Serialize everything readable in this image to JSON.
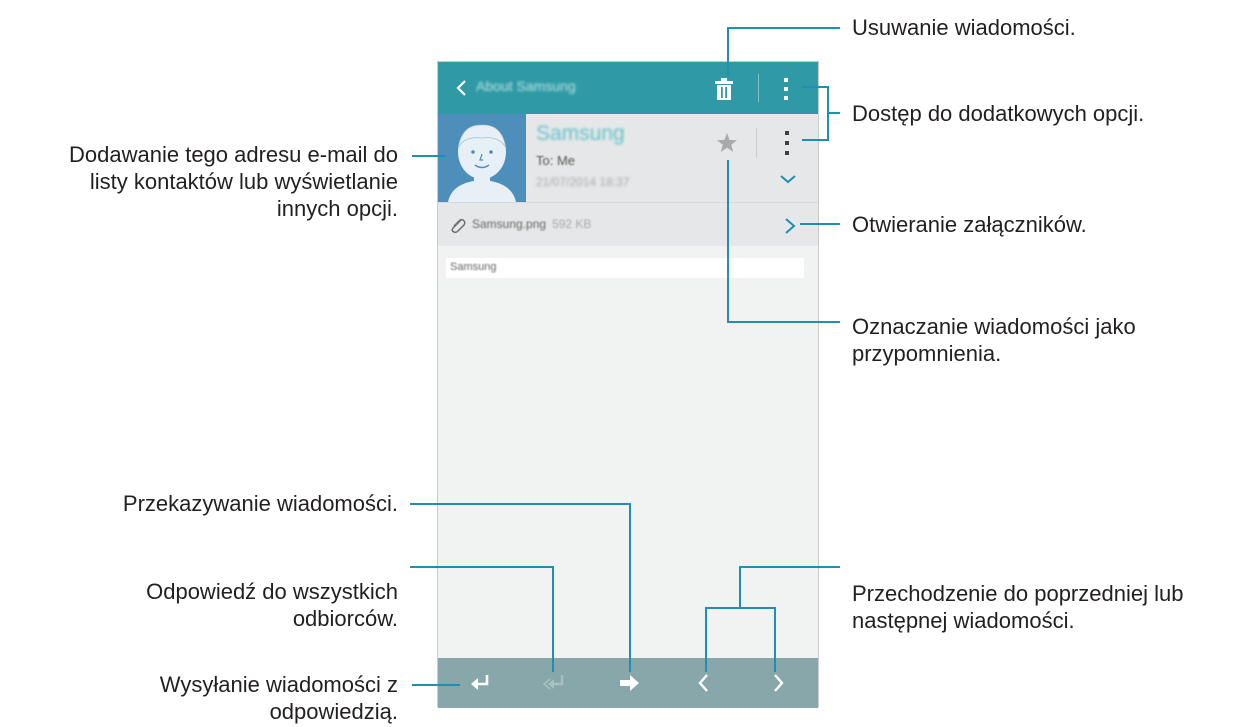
{
  "app": {
    "title": "About Samsung",
    "sender": "Samsung",
    "recipient": "To: Me",
    "date": "21/07/2014 18:37",
    "attachment_name": "Samsung.png",
    "attachment_size": "592 KB",
    "body_text": "Samsung"
  },
  "icons": {
    "back": "chevron-left-icon",
    "delete": "trash-icon",
    "more": "more-vert-icon",
    "star": "star-icon",
    "expand": "chevron-down-icon",
    "attachment": "paperclip-icon",
    "open_attachment": "chevron-right-icon",
    "reply": "reply-icon",
    "reply_all": "reply-all-icon",
    "forward": "forward-icon",
    "previous": "chevron-left-icon",
    "next": "chevron-right-icon"
  },
  "callouts": {
    "delete": "Usuwanie wiadomości.",
    "more_options": "Dostęp do dodatkowych opcji.",
    "add_contact_line1": "Dodawanie tego adresu e-mail do",
    "add_contact_line2": "listy kontaktów lub wyświetlanie",
    "add_contact_line3": "innych opcji.",
    "open_attachments": "Otwieranie załączników.",
    "mark_reminder_line1": "Oznaczanie wiadomości jako",
    "mark_reminder_line2": "przypomnienia.",
    "forward": "Przekazywanie wiadomości.",
    "reply_all_line1": "Odpowiedź do wszystkich",
    "reply_all_line2": "odbiorców.",
    "reply_line1": "Wysyłanie wiadomości z",
    "reply_line2": "odpowiedzią.",
    "navigate_line1": "Przechodzenie do poprzedniej lub",
    "navigate_line2": "następnej wiadomości."
  },
  "colors": {
    "top_bar": "#2f9aa5",
    "bottom_bar": "#87a7aa",
    "callout_line": "#1f8fb3",
    "avatar_bg": "#4d8fba"
  }
}
